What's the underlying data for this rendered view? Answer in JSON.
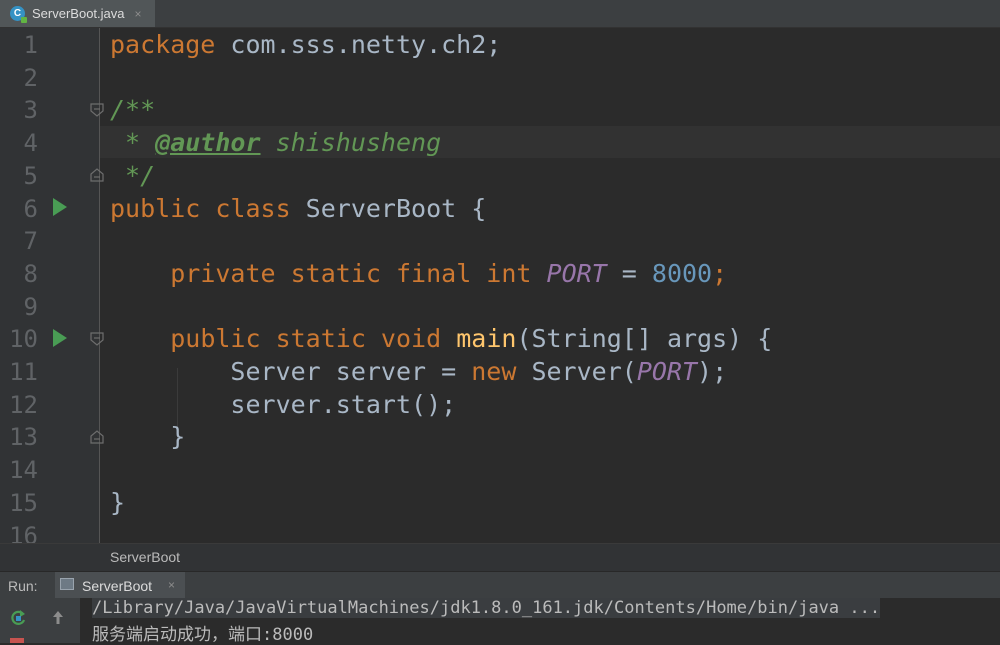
{
  "tab": {
    "label": "ServerBoot.java",
    "icon": "java-class-icon",
    "close": "×"
  },
  "editor": {
    "line_numbers": [
      "1",
      "2",
      "3",
      "4",
      "5",
      "6",
      "7",
      "8",
      "9",
      "10",
      "11",
      "12",
      "13",
      "14",
      "15",
      "16"
    ],
    "code": {
      "l1_kw": "package",
      "l1_rest": " com.sss.netty.ch2;",
      "l3": "/**",
      "l4_star": " * ",
      "l4_tag": "@author",
      "l4_name": " shishusheng",
      "l5": " */",
      "l6_kw": "public class",
      "l6_rest": " ServerBoot {",
      "l8_indent": "    ",
      "l8_kw": "private static final int",
      "l8_sp": " ",
      "l8_const": "PORT",
      "l8_eq": " = ",
      "l8_num": "8000",
      "l8_semi": ";",
      "l10_indent": "    ",
      "l10_kw": "public static void",
      "l10_sp": " ",
      "l10_fn": "main",
      "l10_rest": "(String[] args) {",
      "l11_a": "        Server server = ",
      "l11_kw": "new",
      "l11_b": " Server(",
      "l11_const": "PORT",
      "l11_c": ");",
      "l12": "        server.start();",
      "l13": "    }",
      "l15": "}"
    }
  },
  "breadcrumb": {
    "label": "ServerBoot"
  },
  "run_panel": {
    "label": "Run:",
    "tab_label": "ServerBoot",
    "tab_close": "×",
    "console_lines": [
      "/Library/Java/JavaVirtualMachines/jdk1.8.0_161.jdk/Contents/Home/bin/java ...",
      "服务端启动成功，端口:8000"
    ]
  }
}
